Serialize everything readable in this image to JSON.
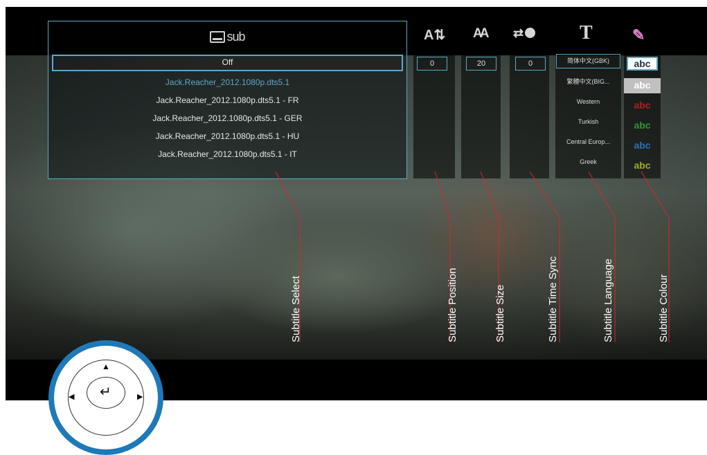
{
  "selector": {
    "header_label": "sub",
    "tracks": [
      "Off",
      "Jack.Reacher_2012.1080p.dts5.1",
      "Jack.Reacher_2012.1080p.dts5.1 - FR",
      "Jack.Reacher_2012.1080p.dts5.1 - GER",
      "Jack.Reacher_2012.1080p.dts5.1 - HU",
      "Jack.Reacher_2012.1080p.dts5.1 - IT"
    ]
  },
  "toolbar": {
    "position_icon": "A⇅",
    "size_icon": "AA",
    "sync_icon": "⇄",
    "language_icon": "T",
    "colour_icon": "✎"
  },
  "values": {
    "position": "0",
    "size": "20",
    "time_sync": "0"
  },
  "languages": [
    "简体中文(GBK)",
    "繁體中文(BIG...",
    "Western",
    "Turkish",
    "Central Europ...",
    "Greek"
  ],
  "colours": {
    "sample_text": "abc",
    "swatches": [
      "#1d2b44",
      "#c0c0c0",
      "#b01f1f",
      "#2a9a2a",
      "#2c6fb8",
      "#a9a922"
    ]
  },
  "callouts": {
    "select": "Subtitle Select",
    "position": "Subtitle Position",
    "size": "Subtitle Size",
    "sync": "Subtitle Time Sync",
    "language": "Subtitle Language",
    "colour": "Subtitle Colour"
  },
  "remote": {
    "up": "▲",
    "down": "▼",
    "left": "◀",
    "right": "▶",
    "ok": "↵"
  },
  "accent_color": "#5fa7c7",
  "callout_line_color": "#d7262b"
}
